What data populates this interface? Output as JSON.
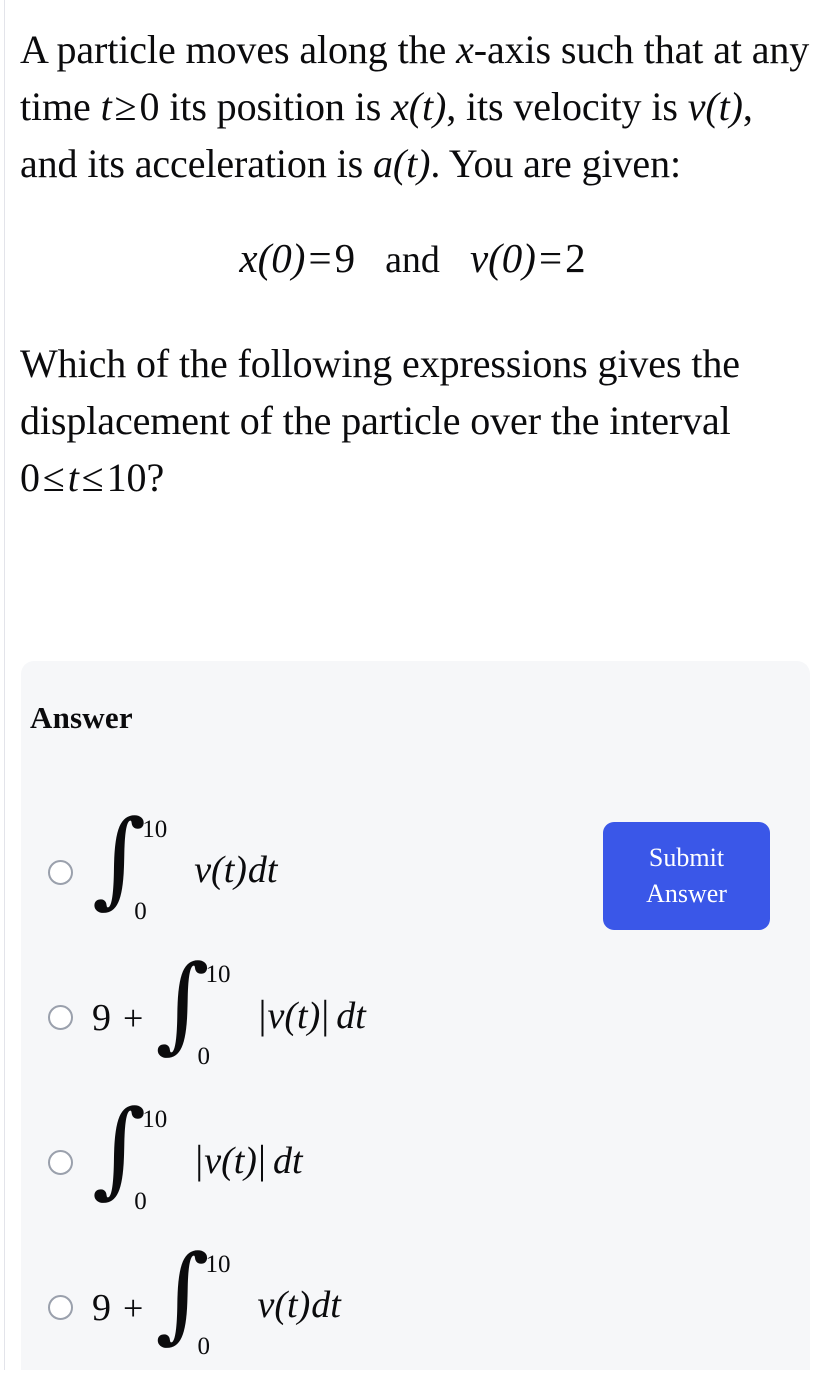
{
  "question": {
    "paragraph_1": {
      "seg_1": "A particle moves along the ",
      "var_x": "x",
      "seg_2": "-axis such that at any time ",
      "var_t": "t",
      "rel_ge": "≥",
      "num_0": "0",
      "seg_3": " its position is ",
      "func_x": "x(t)",
      "seg_4": ", its velocity is ",
      "func_v": "v(t)",
      "seg_5": ", and its acceleration is ",
      "func_a": "a(t)",
      "seg_6": ". You are given:"
    },
    "display_equation": {
      "left_func": "x(0)",
      "left_eq": "=",
      "left_value": "9",
      "conjunction": "and",
      "right_func": "v(0)",
      "right_eq": "=",
      "right_value": "2"
    },
    "paragraph_2": {
      "seg_1": "Which of the following expressions gives the displacement of the particle over the interval ",
      "lower_bound": "0",
      "rel_le_1": "≤",
      "var_t": "t",
      "rel_le_2": "≤",
      "upper_bound": "10",
      "seg_2": "?"
    }
  },
  "answer_card": {
    "title": "Answer",
    "options": [
      {
        "id": "option-1",
        "selected": false,
        "lead": "",
        "plus": "",
        "integral": {
          "lower": "0",
          "upper": "10",
          "sign": "∫"
        },
        "abs": false,
        "integrand": "v(t)",
        "differential": "dt"
      },
      {
        "id": "option-2",
        "selected": false,
        "lead": "9",
        "plus": "+",
        "integral": {
          "lower": "0",
          "upper": "10",
          "sign": "∫"
        },
        "abs": true,
        "integrand": "v(t)",
        "differential": "dt"
      },
      {
        "id": "option-3",
        "selected": false,
        "lead": "",
        "plus": "",
        "integral": {
          "lower": "0",
          "upper": "10",
          "sign": "∫"
        },
        "abs": true,
        "integrand": "v(t)",
        "differential": "dt"
      },
      {
        "id": "option-4",
        "selected": false,
        "lead": "9",
        "plus": "+",
        "integral": {
          "lower": "0",
          "upper": "10",
          "sign": "∫"
        },
        "abs": false,
        "integrand": "v(t)",
        "differential": "dt"
      }
    ],
    "submit_button": {
      "line_1": "Submit",
      "line_2": "Answer"
    }
  },
  "colors": {
    "page_background": "#ffffff",
    "card_background": "#f6f7f9",
    "text": "#0b0b0d",
    "radio_border": "#9aa0ac",
    "submit_blue": "#3a57e8",
    "submit_text": "#ffffff",
    "page_edge": "#e3e4ea"
  }
}
